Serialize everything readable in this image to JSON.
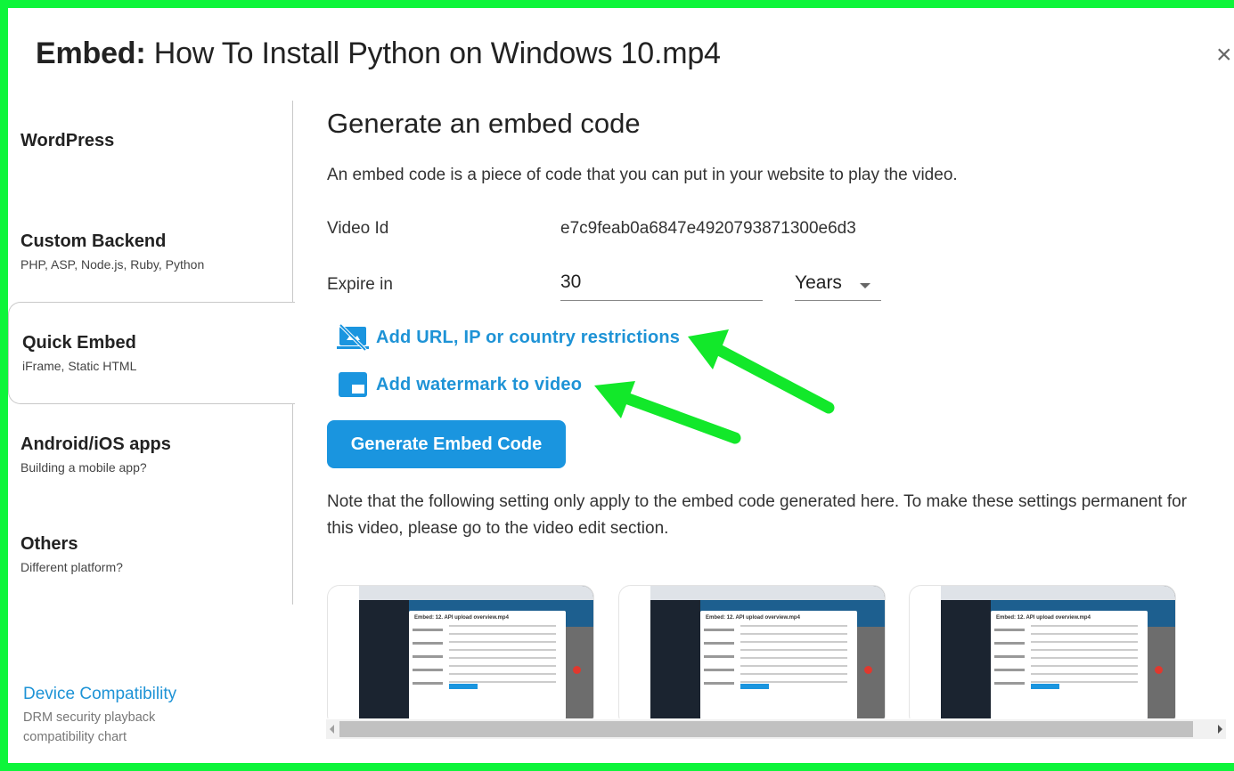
{
  "dialog": {
    "title_prefix": "Embed:",
    "title_file": "How To Install Python on Windows 10.mp4",
    "close_icon": "×"
  },
  "sidebar": {
    "items": [
      {
        "title": "WordPress",
        "subtitle": "",
        "active": false
      },
      {
        "title": "Custom Backend",
        "subtitle": "PHP, ASP, Node.js, Ruby, Python",
        "active": false
      },
      {
        "title": "Quick Embed",
        "subtitle": "iFrame, Static HTML",
        "active": true
      },
      {
        "title": "Android/iOS apps",
        "subtitle": "Building a mobile app?",
        "active": false
      },
      {
        "title": "Others",
        "subtitle": "Different platform?",
        "active": false
      }
    ],
    "device_compat": {
      "link": "Device Compatibility",
      "desc_line1": "DRM security playback",
      "desc_line2": "compatibility chart"
    }
  },
  "main": {
    "section_title": "Generate an embed code",
    "intro": "An embed code is a piece of code that you can put in your website to play the video.",
    "video_id_label": "Video Id",
    "video_id_value": "e7c9feab0a6847e4920793871300e6d3",
    "expire_label": "Expire in",
    "expire_value": "30",
    "expire_unit": "Years",
    "restrictions_link": "Add URL, IP or country restrictions",
    "restrictions_icon": "no-web-restriction-icon",
    "watermark_link": "Add watermark to video",
    "watermark_icon": "watermark-icon",
    "generate_button": "Generate Embed Code",
    "note": "Note that the following setting only apply to the embed code generated here. To make these settings permanent for this video, please go to the video edit section.",
    "accent_color": "#1e93d6"
  },
  "thumbnails": [
    {
      "caption": "Embed: 12. API upload overview.mp4"
    },
    {
      "caption": "Embed: 12. API upload overview.mp4"
    },
    {
      "caption": "Embed: 12. API upload overview.mp4"
    }
  ],
  "annotation": {
    "arrow_color": "#12e82a"
  }
}
